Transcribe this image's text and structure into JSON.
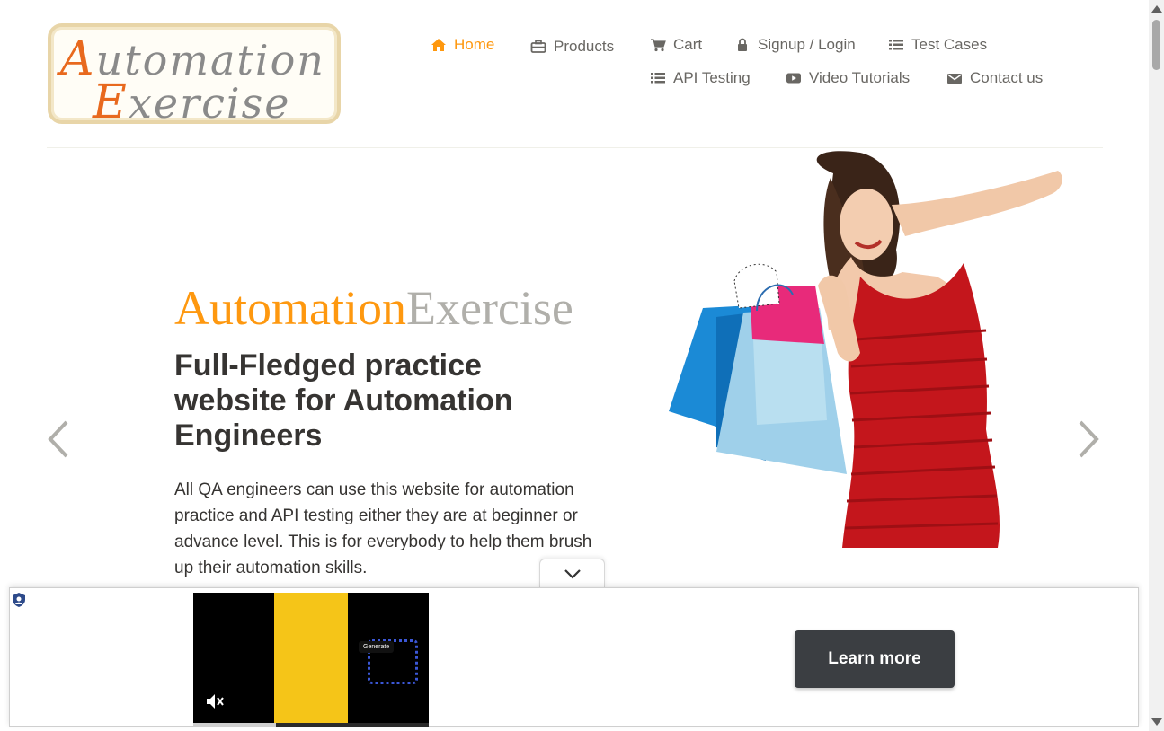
{
  "logo": {
    "line1_cap": "A",
    "line1_rest": "utomation",
    "line2_cap": "E",
    "line2_rest": "xercise"
  },
  "nav": {
    "items": [
      {
        "label": "Home",
        "icon": "home-icon",
        "active": true
      },
      {
        "label": "Products",
        "icon": "briefcase-icon"
      },
      {
        "label": "Cart",
        "icon": "cart-icon"
      },
      {
        "label": "Signup / Login",
        "icon": "lock-icon"
      },
      {
        "label": "Test Cases",
        "icon": "list-icon"
      },
      {
        "label": "API Testing",
        "icon": "list-icon"
      },
      {
        "label": "Video Tutorials",
        "icon": "youtube-icon"
      },
      {
        "label": "Contact us",
        "icon": "envelope-icon"
      }
    ],
    "active_color": "#fe980f"
  },
  "hero": {
    "brand_part1": "Automation",
    "brand_part2": "Exercise",
    "headline": "Full-Fledged practice website for Automation Engineers",
    "paragraph": "All QA engineers can use this website for automation practice and API testing either they are at beginner or advance level. This is for everybody to help them brush up their automation skills.",
    "image": "woman-with-shopping-bags-image"
  },
  "ad": {
    "chip_text": "Generate",
    "cta_label": "Learn more",
    "video_progress_percent": 35,
    "muted": true
  },
  "colors": {
    "accent": "#fe980f",
    "text": "#363432",
    "nav_text": "#696763",
    "brand_grey": "#b0afaa"
  }
}
